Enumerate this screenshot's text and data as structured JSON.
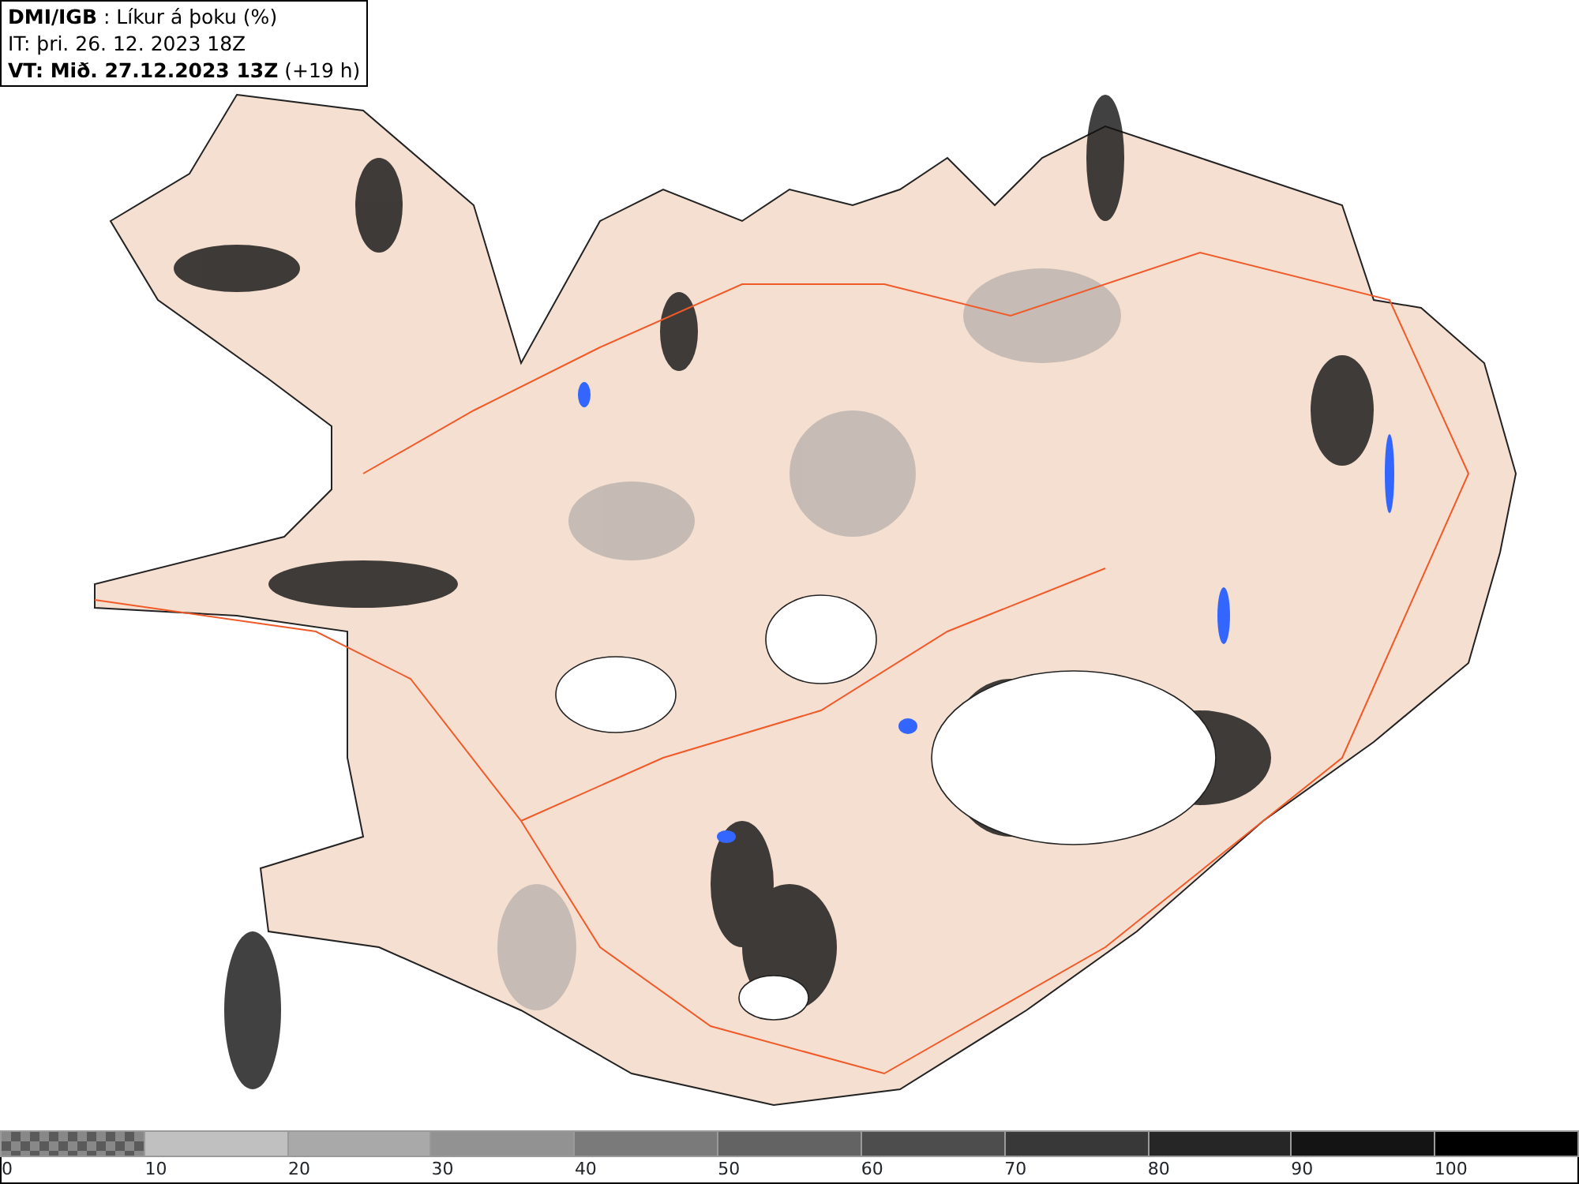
{
  "header": {
    "lines": [
      "**DMI/IGB** : Líkur á þoku (%)",
      "IT: þri. 26. 12. 2023 18Z",
      "**VT: Mið. 27.12.2023 13Z** (+19 h)"
    ]
  },
  "legend": [
    {
      "kind": "checker",
      "color": "#5a5a5a",
      "label": "0"
    },
    {
      "kind": "solid",
      "color": "#c0c0c0",
      "label": "10"
    },
    {
      "kind": "solid",
      "color": "#a9a9a9",
      "label": "20"
    },
    {
      "kind": "solid",
      "color": "#929292",
      "label": "30"
    },
    {
      "kind": "solid",
      "color": "#7a7a7a",
      "label": "40"
    },
    {
      "kind": "solid",
      "color": "#636363",
      "label": "50"
    },
    {
      "kind": "solid",
      "color": "#4d4d4d",
      "label": "60"
    },
    {
      "kind": "solid",
      "color": "#383838",
      "label": "70"
    },
    {
      "kind": "solid",
      "color": "#262626",
      "label": "80"
    },
    {
      "kind": "solid",
      "color": "#141414",
      "label": "90"
    },
    {
      "kind": "solid",
      "color": "#000000",
      "label": "100"
    }
  ]
}
